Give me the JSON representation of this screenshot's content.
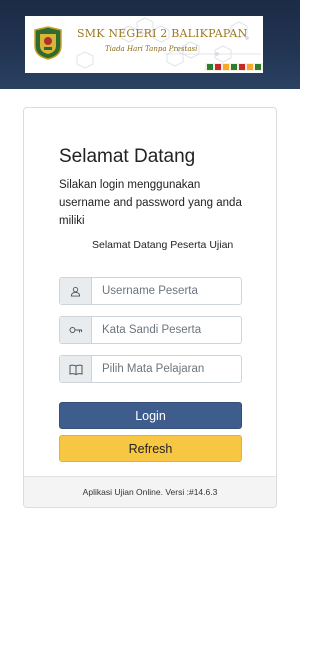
{
  "header": {
    "school_name": "SMK NEGERI 2 BALIKPAPAN",
    "motto": "Tiada Hari Tanpa Prestasi",
    "logo_icon": "school-crest-icon",
    "colors": {
      "bar": "#223554",
      "gold": "#9b7a1f"
    }
  },
  "login": {
    "title": "Selamat Datang",
    "subtitle": "Silakan login menggunakan username and password yang anda miliki",
    "welcome": "Selamat Datang Peserta Ujian",
    "username": {
      "placeholder": "Username Peserta",
      "icon": "user-icon"
    },
    "password": {
      "placeholder": "Kata Sandi Peserta",
      "icon": "key-icon"
    },
    "subject": {
      "value": "Pilih Mata Pelajaran",
      "icon": "book-icon"
    },
    "login_label": "Login",
    "refresh_label": "Refresh",
    "footer": "Aplikasi Ujian Online. Versi :#14.6.3",
    "colors": {
      "login": "#3e5d8c",
      "refresh": "#f7c744"
    }
  }
}
